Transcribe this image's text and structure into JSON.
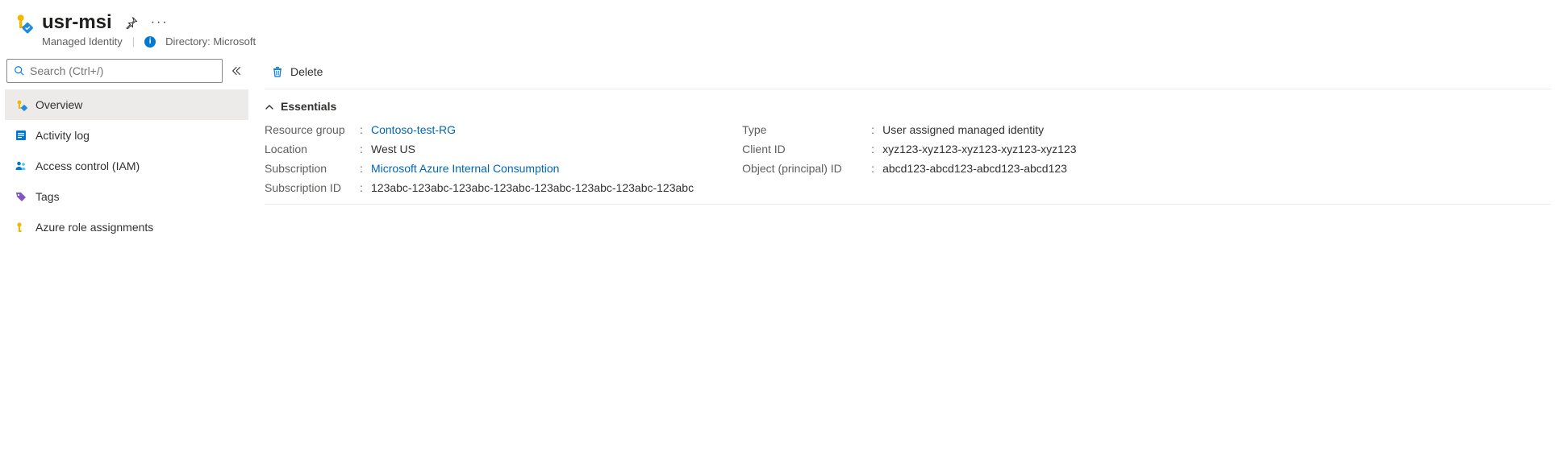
{
  "header": {
    "title": "usr-msi",
    "resource_type": "Managed Identity",
    "directory_label": "Directory: Microsoft"
  },
  "search": {
    "placeholder": "Search (Ctrl+/)"
  },
  "sidebar": {
    "items": [
      {
        "label": "Overview",
        "icon": "key-badge",
        "selected": true
      },
      {
        "label": "Activity log",
        "icon": "log",
        "selected": false
      },
      {
        "label": "Access control (IAM)",
        "icon": "people",
        "selected": false
      },
      {
        "label": "Tags",
        "icon": "tag",
        "selected": false
      },
      {
        "label": "Azure role assignments",
        "icon": "key",
        "selected": false
      }
    ]
  },
  "toolbar": {
    "delete_label": "Delete"
  },
  "essentials": {
    "title": "Essentials",
    "left": {
      "resource_group_label": "Resource group",
      "resource_group_value": "Contoso-test-RG",
      "location_label": "Location",
      "location_value": "West US",
      "subscription_label": "Subscription",
      "subscription_value": "Microsoft Azure Internal Consumption",
      "subscription_id_label": "Subscription ID",
      "subscription_id_value": "123abc-123abc-123abc-123abc-123abc-123abc-123abc-123abc"
    },
    "right": {
      "type_label": "Type",
      "type_value": "User assigned managed identity",
      "client_id_label": "Client ID",
      "client_id_value": "xyz123-xyz123-xyz123-xyz123-xyz123",
      "object_id_label": "Object (principal) ID",
      "object_id_value": "abcd123-abcd123-abcd123-abcd123"
    }
  }
}
